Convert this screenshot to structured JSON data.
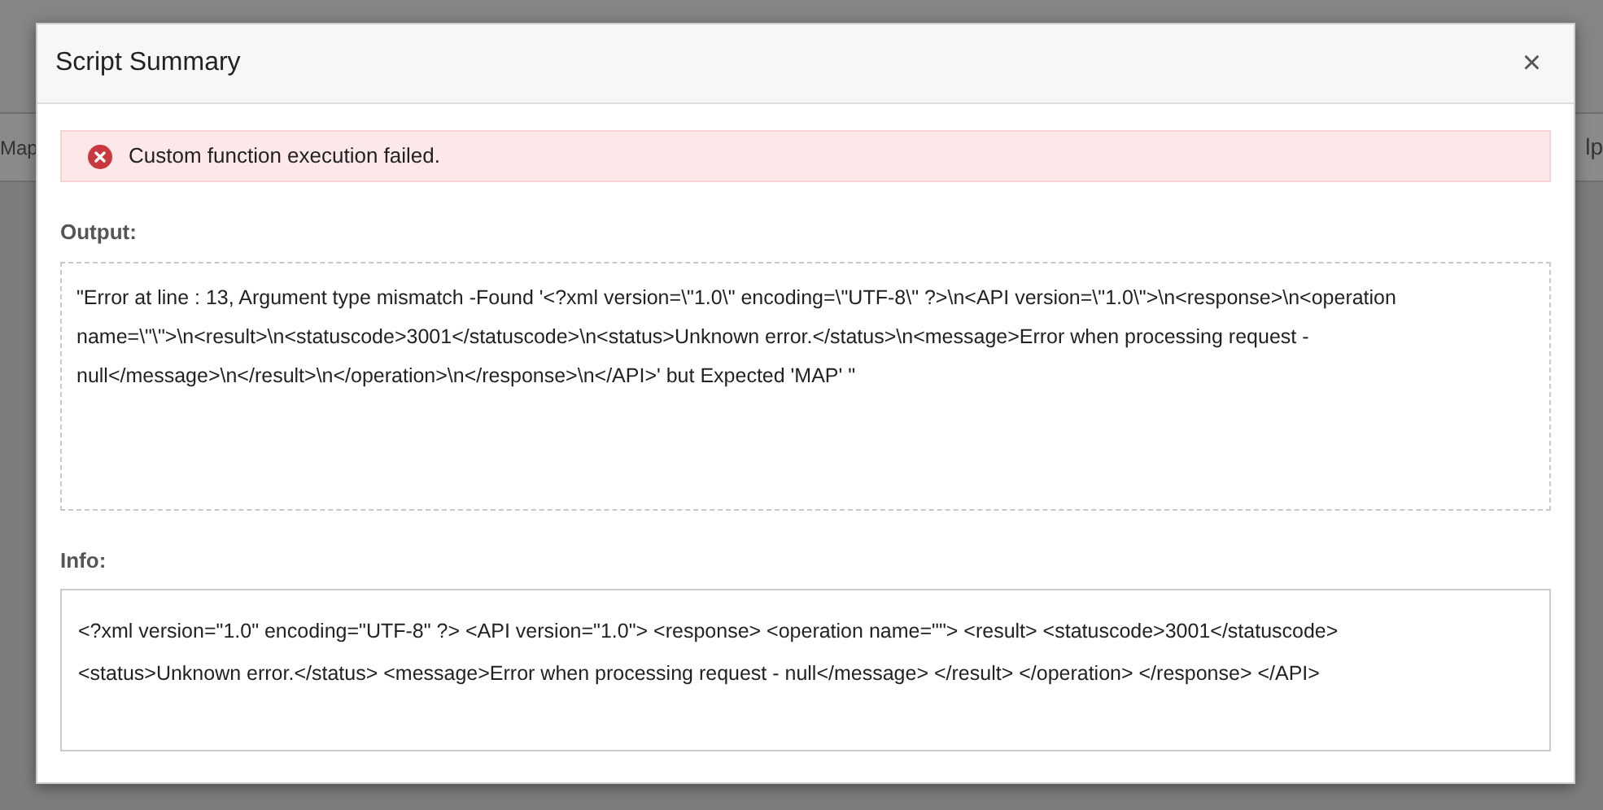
{
  "background": {
    "left_tab": "Map",
    "right_tab": "lp"
  },
  "dialog": {
    "title": "Script Summary",
    "close": "×",
    "alert": {
      "kind": "error",
      "message": "Custom function execution failed."
    },
    "sections": [
      {
        "label": "Output:",
        "kind": "dashed",
        "text": "\"Error at line : 13, Argument type mismatch -Found '<?xml version=\\\"1.0\\\" encoding=\\\"UTF-8\\\" ?>\\n<API version=\\\"1.0\\\">\\n<response>\\n<operation name=\\\"\\\">\\n<result>\\n<statuscode>3001</statuscode>\\n<status>Unknown error.</status>\\n<message>Error when processing request - null</message>\\n</result>\\n</operation>\\n</response>\\n</API>' but Expected 'MAP' \""
      },
      {
        "label": "Info:",
        "kind": "solid",
        "text": "<?xml version=\"1.0\" encoding=\"UTF-8\" ?> <API version=\"1.0\"> <response> <operation name=\"\"> <result> <statuscode>3001</statuscode> <status>Unknown error.</status> <message>Error when processing request - null</message> </result> </operation> </response> </API>"
      }
    ]
  }
}
